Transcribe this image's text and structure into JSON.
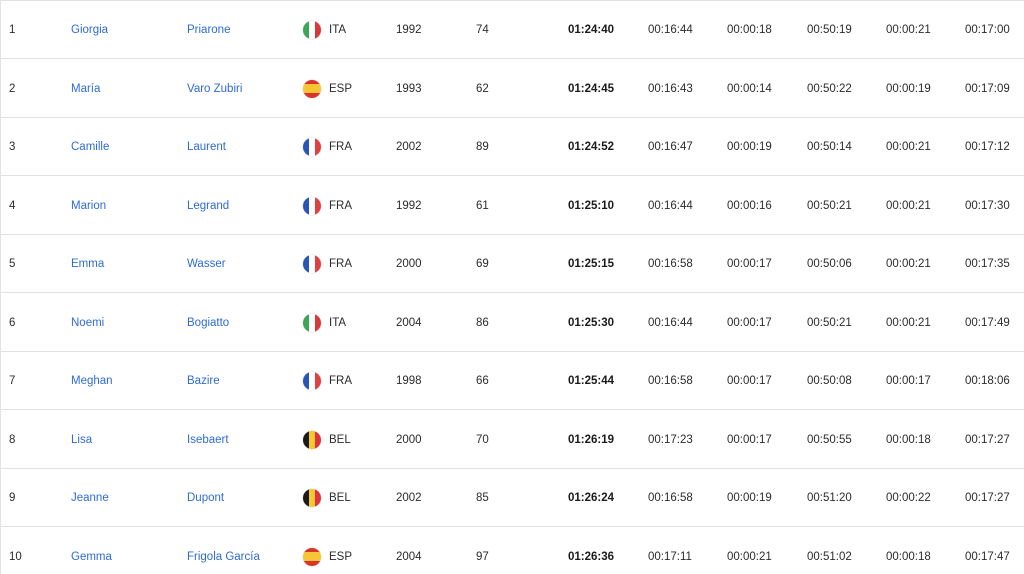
{
  "flags": {
    "ITA": {
      "direction": "h",
      "colors": [
        "#3aa656",
        "#ffffff",
        "#d63a3a"
      ],
      "icon": "italy-flag-icon"
    },
    "ESP": {
      "direction": "v",
      "colors": [
        "#d9342b",
        "#f5c533",
        "#d9342b"
      ],
      "icon": "spain-flag-icon"
    },
    "FRA": {
      "direction": "h",
      "colors": [
        "#2a55b8",
        "#ffffff",
        "#e04040"
      ],
      "icon": "france-flag-icon"
    },
    "BEL": {
      "direction": "h",
      "colors": [
        "#1a1a1a",
        "#f5c92f",
        "#e0323a"
      ],
      "icon": "belgium-flag-icon"
    }
  },
  "results": [
    {
      "rank": "1",
      "first": "Giorgia",
      "last": "Priarone",
      "nat": "ITA",
      "year": "1992",
      "bib": "74",
      "total": "01:24:40",
      "swim": "00:16:44",
      "t1": "00:00:18",
      "bike": "00:50:19",
      "t2": "00:00:21",
      "run": "00:17:00"
    },
    {
      "rank": "2",
      "first": "María",
      "last": "Varo Zubiri",
      "nat": "ESP",
      "year": "1993",
      "bib": "62",
      "total": "01:24:45",
      "swim": "00:16:43",
      "t1": "00:00:14",
      "bike": "00:50:22",
      "t2": "00:00:19",
      "run": "00:17:09"
    },
    {
      "rank": "3",
      "first": "Camille",
      "last": "Laurent",
      "nat": "FRA",
      "year": "2002",
      "bib": "89",
      "total": "01:24:52",
      "swim": "00:16:47",
      "t1": "00:00:19",
      "bike": "00:50:14",
      "t2": "00:00:21",
      "run": "00:17:12"
    },
    {
      "rank": "4",
      "first": "Marion",
      "last": "Legrand",
      "nat": "FRA",
      "year": "1992",
      "bib": "61",
      "total": "01:25:10",
      "swim": "00:16:44",
      "t1": "00:00:16",
      "bike": "00:50:21",
      "t2": "00:00:21",
      "run": "00:17:30"
    },
    {
      "rank": "5",
      "first": "Emma",
      "last": "Wasser",
      "nat": "FRA",
      "year": "2000",
      "bib": "69",
      "total": "01:25:15",
      "swim": "00:16:58",
      "t1": "00:00:17",
      "bike": "00:50:06",
      "t2": "00:00:21",
      "run": "00:17:35"
    },
    {
      "rank": "6",
      "first": "Noemi",
      "last": "Bogiatto",
      "nat": "ITA",
      "year": "2004",
      "bib": "86",
      "total": "01:25:30",
      "swim": "00:16:44",
      "t1": "00:00:17",
      "bike": "00:50:21",
      "t2": "00:00:21",
      "run": "00:17:49"
    },
    {
      "rank": "7",
      "first": "Meghan",
      "last": "Bazire",
      "nat": "FRA",
      "year": "1998",
      "bib": "66",
      "total": "01:25:44",
      "swim": "00:16:58",
      "t1": "00:00:17",
      "bike": "00:50:08",
      "t2": "00:00:17",
      "run": "00:18:06"
    },
    {
      "rank": "8",
      "first": "Lisa",
      "last": "Isebaert",
      "nat": "BEL",
      "year": "2000",
      "bib": "70",
      "total": "01:26:19",
      "swim": "00:17:23",
      "t1": "00:00:17",
      "bike": "00:50:55",
      "t2": "00:00:18",
      "run": "00:17:27"
    },
    {
      "rank": "9",
      "first": "Jeanne",
      "last": "Dupont",
      "nat": "BEL",
      "year": "2002",
      "bib": "85",
      "total": "01:26:24",
      "swim": "00:16:58",
      "t1": "00:00:19",
      "bike": "00:51:20",
      "t2": "00:00:22",
      "run": "00:17:27"
    },
    {
      "rank": "10",
      "first": "Gemma",
      "last": "Frigola García",
      "nat": "ESP",
      "year": "2004",
      "bib": "97",
      "total": "01:26:36",
      "swim": "00:17:11",
      "t1": "00:00:21",
      "bike": "00:51:02",
      "t2": "00:00:18",
      "run": "00:17:47"
    }
  ]
}
